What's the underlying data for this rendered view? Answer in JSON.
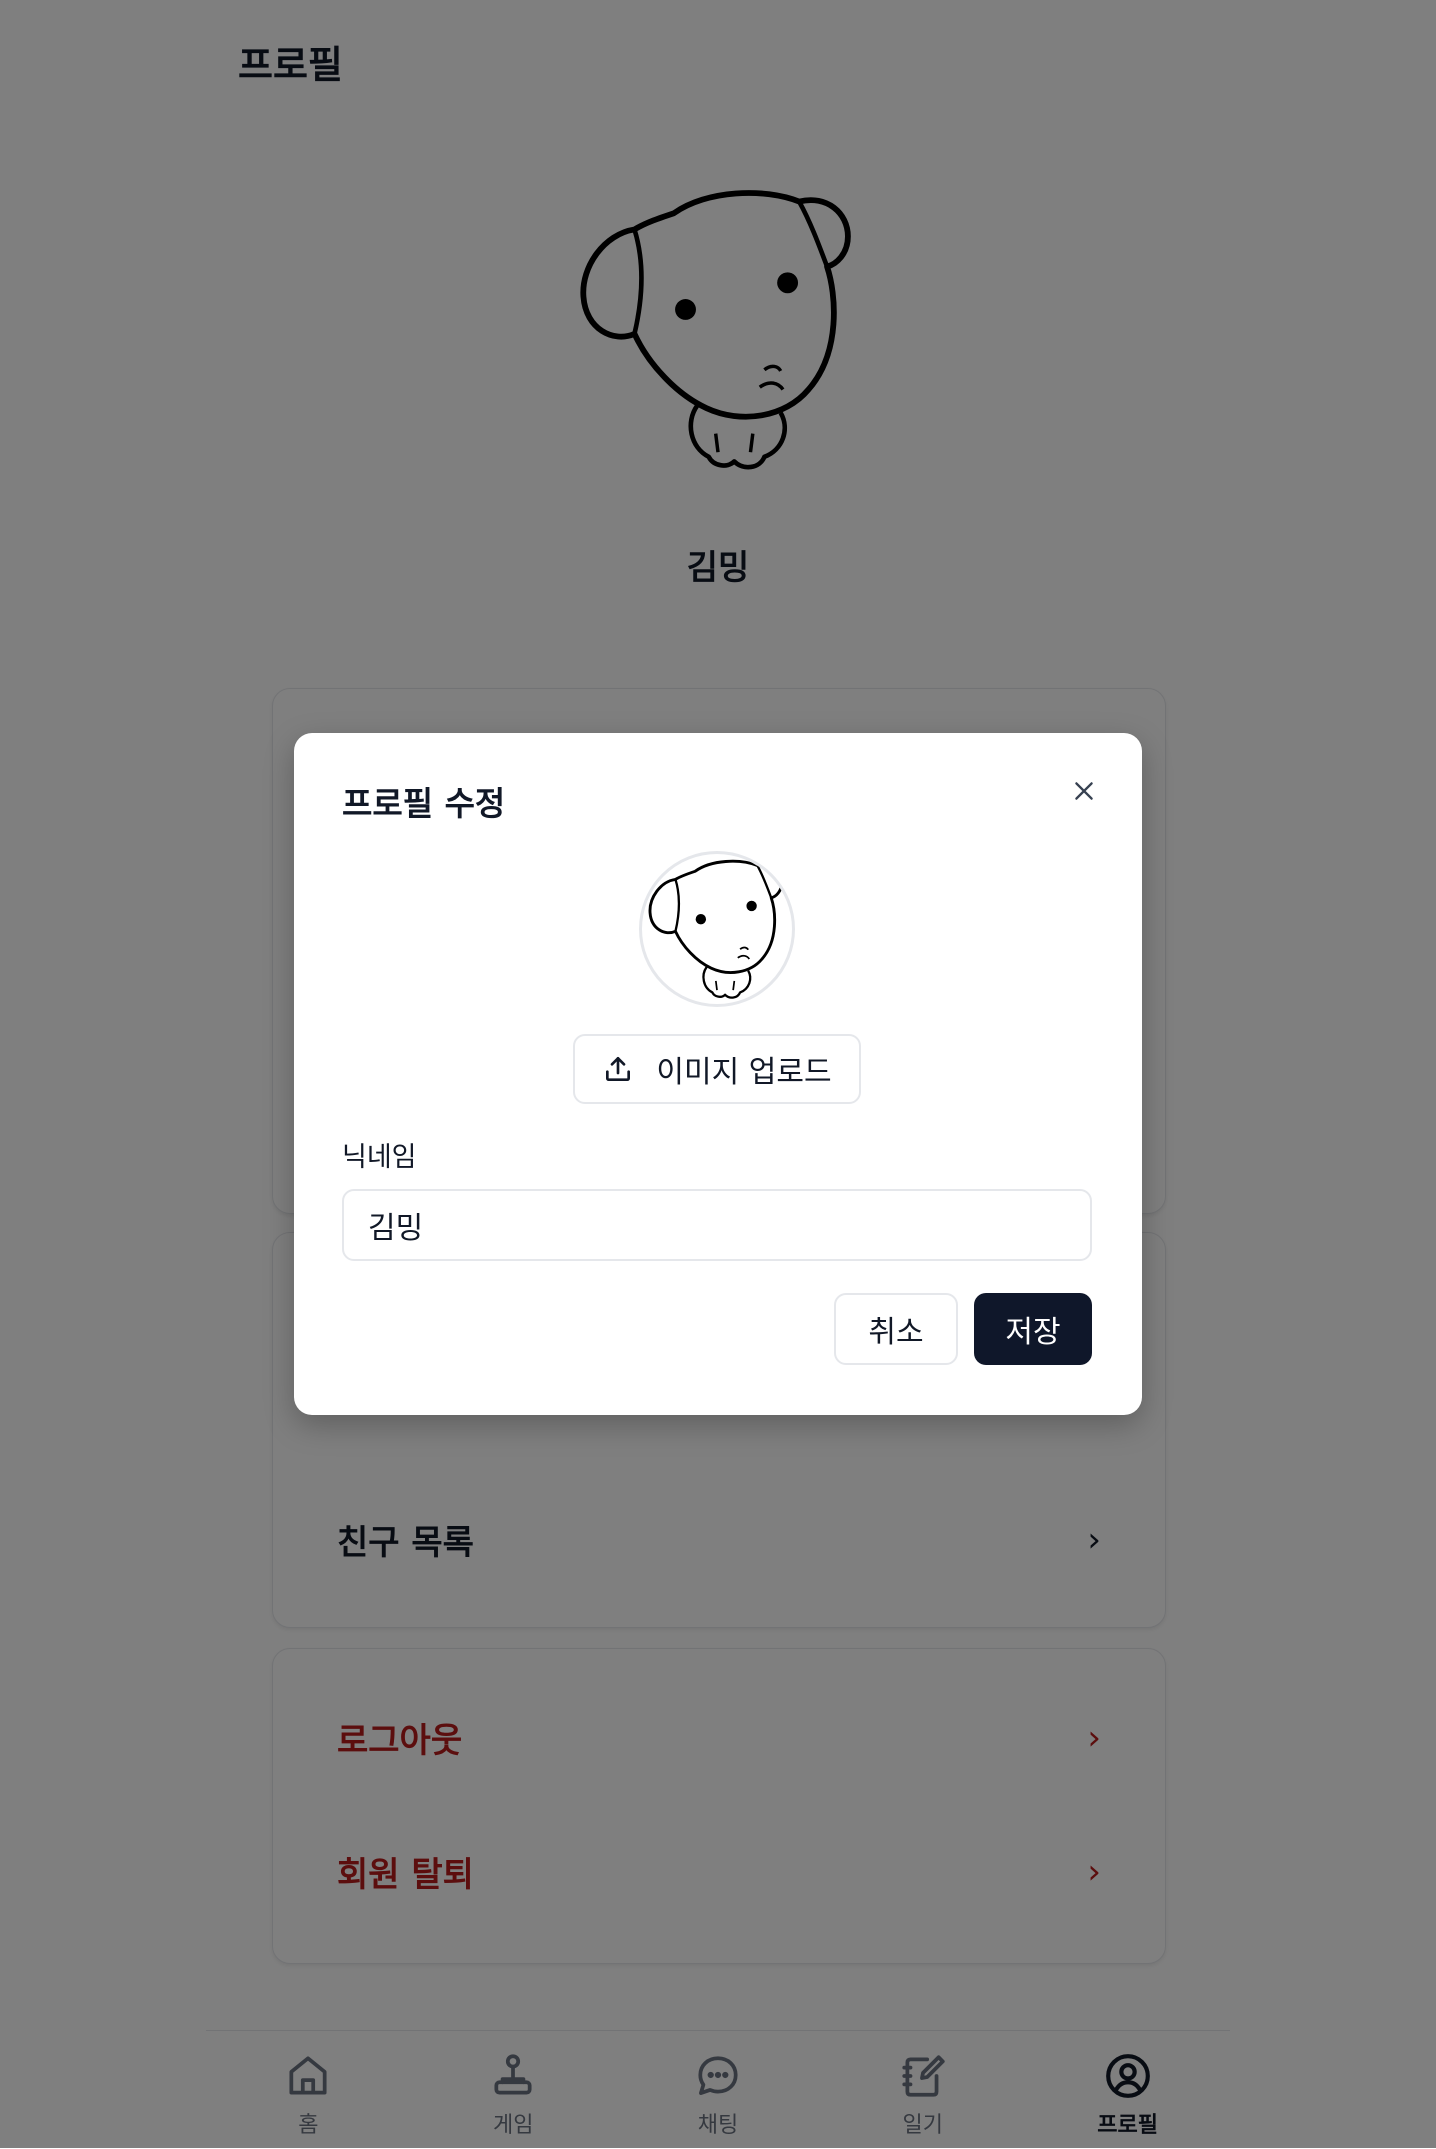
{
  "header": {
    "title": "프로필"
  },
  "profile": {
    "nickname": "김밍",
    "avatar_icon": "puppy-drawing"
  },
  "menu": {
    "friends_label": "친구 목록",
    "logout_label": "로그아웃",
    "withdraw_label": "회원 탈퇴",
    "chevron": "›",
    "danger_color": "#b91c1c"
  },
  "bottom_nav": {
    "items": [
      {
        "label": "홈",
        "icon": "home-icon"
      },
      {
        "label": "게임",
        "icon": "joystick-icon"
      },
      {
        "label": "채팅",
        "icon": "chat-bubble-icon"
      },
      {
        "label": "일기",
        "icon": "notebook-pen-icon"
      },
      {
        "label": "프로필",
        "icon": "user-circle-icon",
        "active": true
      }
    ]
  },
  "modal": {
    "title": "프로필 수정",
    "close_icon": "close-icon",
    "upload_label": "이미지 업로드",
    "upload_icon": "upload-icon",
    "nickname_label": "닉네임",
    "nickname_value": "김밍",
    "cancel_label": "취소",
    "save_label": "저장",
    "primary_color": "#0f172a"
  },
  "overlay_color": "rgba(0,0,0,0.5)"
}
